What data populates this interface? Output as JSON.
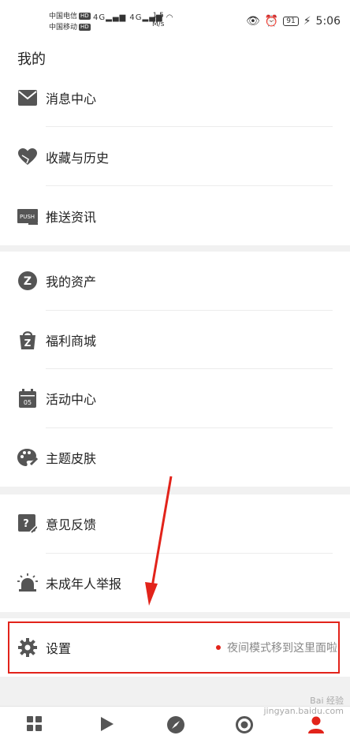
{
  "status_bar": {
    "carrier1": "中国电信",
    "carrier2": "中国移动",
    "hd_badge": "HD",
    "net1": "4G",
    "net2": "4G",
    "speed_value": "1.5",
    "speed_unit": "M/s",
    "battery": "91",
    "time": "5:06"
  },
  "header": {
    "title": "我的"
  },
  "groups": [
    {
      "items": [
        {
          "label": "消息中心",
          "icon": "envelope-icon"
        },
        {
          "label": "收藏与历史",
          "icon": "heart-icon"
        },
        {
          "label": "推送资讯",
          "icon": "push-icon",
          "icon_text": "PUSH"
        }
      ]
    },
    {
      "items": [
        {
          "label": "我的资产",
          "icon": "assets-icon",
          "icon_text": "Z"
        },
        {
          "label": "福利商城",
          "icon": "shopping-bag-icon",
          "icon_text": "Z"
        },
        {
          "label": "活动中心",
          "icon": "calendar-icon",
          "icon_text": "05"
        },
        {
          "label": "主题皮肤",
          "icon": "palette-icon"
        }
      ]
    },
    {
      "items": [
        {
          "label": "意见反馈",
          "icon": "feedback-icon",
          "icon_text": "?"
        },
        {
          "label": "未成年人举报",
          "icon": "alarm-icon"
        }
      ]
    }
  ],
  "settings": {
    "label": "设置",
    "icon": "gear-icon",
    "note": "夜间模式移到这里面啦"
  },
  "tabbar": [
    {
      "icon": "grid-icon"
    },
    {
      "icon": "play-icon"
    },
    {
      "icon": "compass-icon"
    },
    {
      "icon": "record-icon"
    },
    {
      "icon": "profile-icon"
    }
  ],
  "watermark": {
    "line1": "Bai 经验",
    "line2": "jingyan.baidu.com"
  },
  "colors": {
    "accent_red": "#e2231a",
    "icon_gray": "#555555",
    "background": "#f1f1f1"
  }
}
